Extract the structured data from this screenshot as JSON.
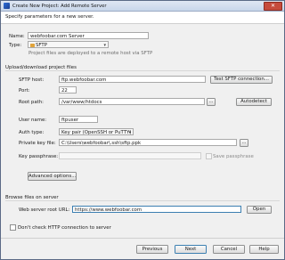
{
  "window": {
    "title": "Create New Project: Add Remote Server",
    "close_glyph": "✕"
  },
  "header": {
    "text": "Specify parameters for a new server."
  },
  "form": {
    "name_label": "Name:",
    "name_value": "webfoobar.com Server",
    "type_label": "Type:",
    "type_value": "SFTP",
    "type_hint": "Project files are deployed to a remote host via SFTP"
  },
  "upload": {
    "section_label": "Upload/download project files",
    "host_label": "SFTP host:",
    "host_value": "ftp.webfoobar.com",
    "test_button": "Test SFTP connection...",
    "port_label": "Port:",
    "port_value": "22",
    "root_label": "Root path:",
    "root_value": "/var/www/htdocs",
    "browse_glyph": "...",
    "autodetect_button": "Autodetect",
    "user_label": "User name:",
    "user_value": "ftpuser",
    "auth_label": "Auth type:",
    "auth_value": "Key pair (OpenSSH or PuTTY)",
    "key_label": "Private key file:",
    "key_value": "C:\\Users\\webfoobar\\.ssh\\sftp.ppk",
    "passphrase_label": "Key passphrase:",
    "save_passphrase_label": "Save passphrase",
    "advanced_button": "Advanced options..."
  },
  "browse": {
    "section_label": "Browse files on server",
    "url_label": "Web server root URL:",
    "url_value": "https://www.webfoobar.com",
    "open_button": "Open"
  },
  "http_check_label": "Don't check HTTP connection to server",
  "footer": {
    "previous": "Previous",
    "next": "Next",
    "cancel": "Cancel",
    "help": "Help"
  },
  "colors": {
    "accent": "#3c7fb1",
    "close": "#c64b3c"
  },
  "icons": {
    "app": "app-icon",
    "sftp": "sftp-folder-icon",
    "dropdown": "chevron-down-icon"
  }
}
